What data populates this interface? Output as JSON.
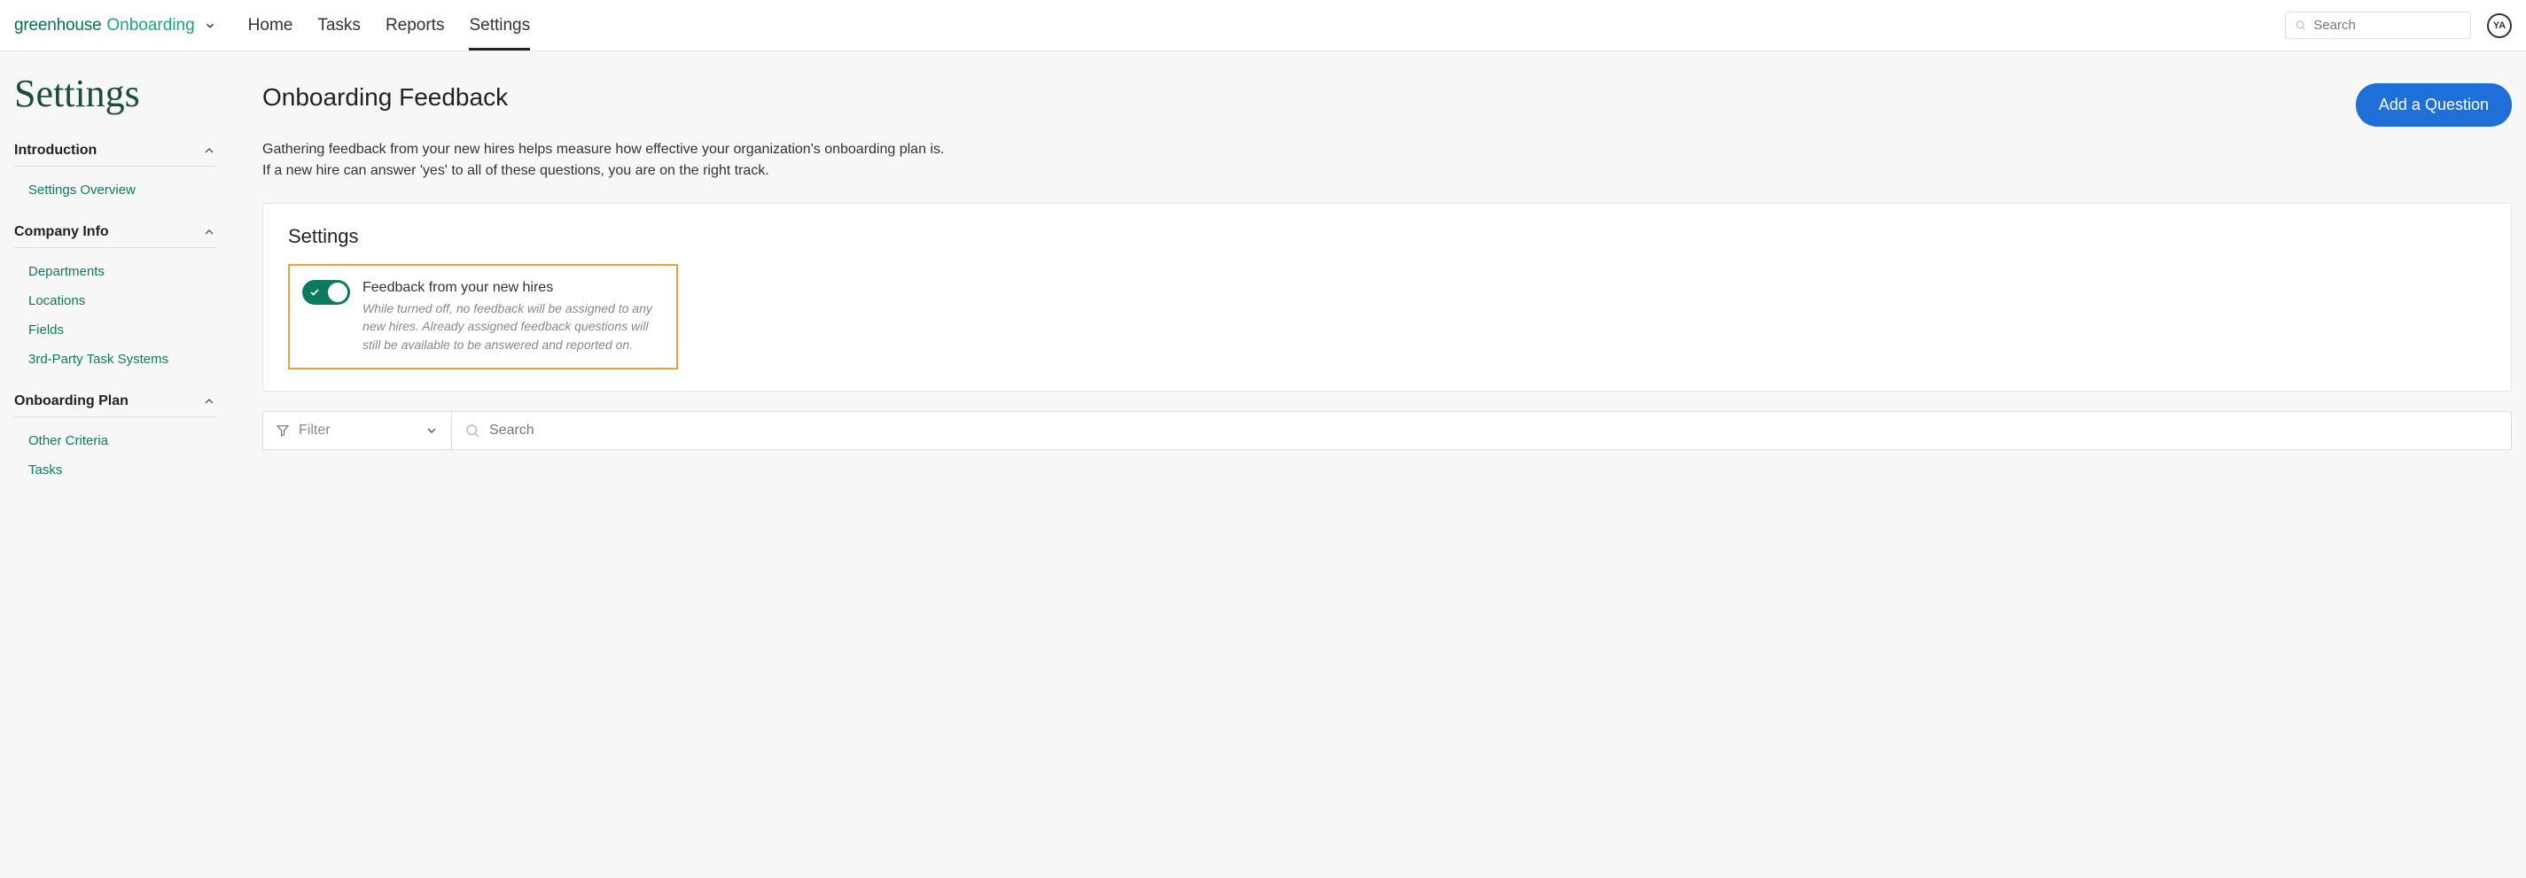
{
  "brand": {
    "part1": "greenhouse",
    "part2": "Onboarding"
  },
  "nav": {
    "items": [
      {
        "label": "Home"
      },
      {
        "label": "Tasks"
      },
      {
        "label": "Reports"
      },
      {
        "label": "Settings"
      }
    ],
    "search_placeholder": "Search"
  },
  "avatar": {
    "initials": "YA"
  },
  "page": {
    "title": "Settings"
  },
  "sidebar": {
    "sections": [
      {
        "title": "Introduction",
        "items": [
          {
            "label": "Settings Overview"
          }
        ]
      },
      {
        "title": "Company Info",
        "items": [
          {
            "label": "Departments"
          },
          {
            "label": "Locations"
          },
          {
            "label": "Fields"
          },
          {
            "label": "3rd-Party Task Systems"
          }
        ]
      },
      {
        "title": "Onboarding Plan",
        "items": [
          {
            "label": "Other Criteria"
          },
          {
            "label": "Tasks"
          }
        ]
      }
    ]
  },
  "main": {
    "title": "Onboarding Feedback",
    "add_button": "Add a Question",
    "description_line1": "Gathering feedback from your new hires helps measure how effective your organization's onboarding plan is.",
    "description_line2": "If a new hire can answer 'yes' to all of these questions, you are on the right track.",
    "card": {
      "title": "Settings",
      "toggle_label": "Feedback from your new hires",
      "toggle_sub": "While turned off, no feedback will be assigned to any new hires. Already assigned feedback questions will still be available to be answered and reported on."
    },
    "filter": {
      "label": "Filter",
      "search_placeholder": "Search"
    }
  }
}
